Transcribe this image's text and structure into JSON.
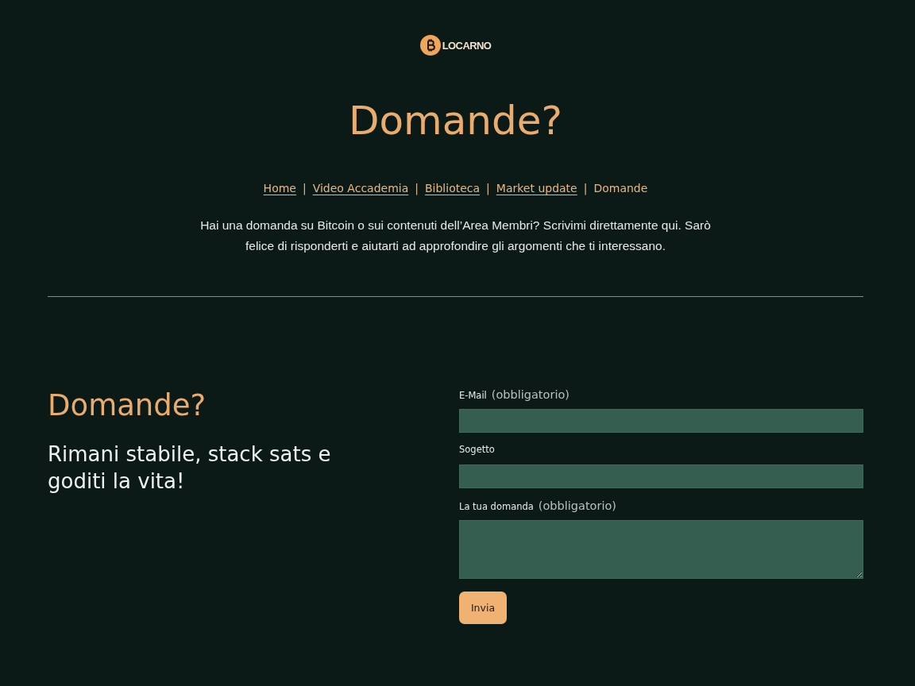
{
  "logo": {
    "text": "LOCARNO"
  },
  "page_title": "Domande?",
  "nav": {
    "items": [
      {
        "label": "Home",
        "selected": false
      },
      {
        "label": "Video Accademia",
        "selected": false
      },
      {
        "label": "Biblioteca",
        "selected": false
      },
      {
        "label": "Market update",
        "selected": false
      },
      {
        "label": "Domande",
        "selected": true
      }
    ],
    "separators": [
      "|",
      "|",
      "|",
      "|"
    ]
  },
  "intro": "Hai una domanda su Bitcoin o sui contenuti dell’Area Membri? Scrivimi direttamente qui. Sarò felice di risponderti e aiutarti ad approfondire gli argomenti che ti interessano.",
  "contact": {
    "heading": "Domande?",
    "tagline": "Rimani stabile, stack sats e goditi la vita!"
  },
  "form": {
    "fields": [
      {
        "kind": "input",
        "label": "E-Mail",
        "note": "(obbligatorio)"
      },
      {
        "kind": "input",
        "label": "Sogetto"
      },
      {
        "kind": "textarea",
        "label": "La tua domanda",
        "note": "(obbligatorio)"
      }
    ],
    "submit": "Invia"
  }
}
